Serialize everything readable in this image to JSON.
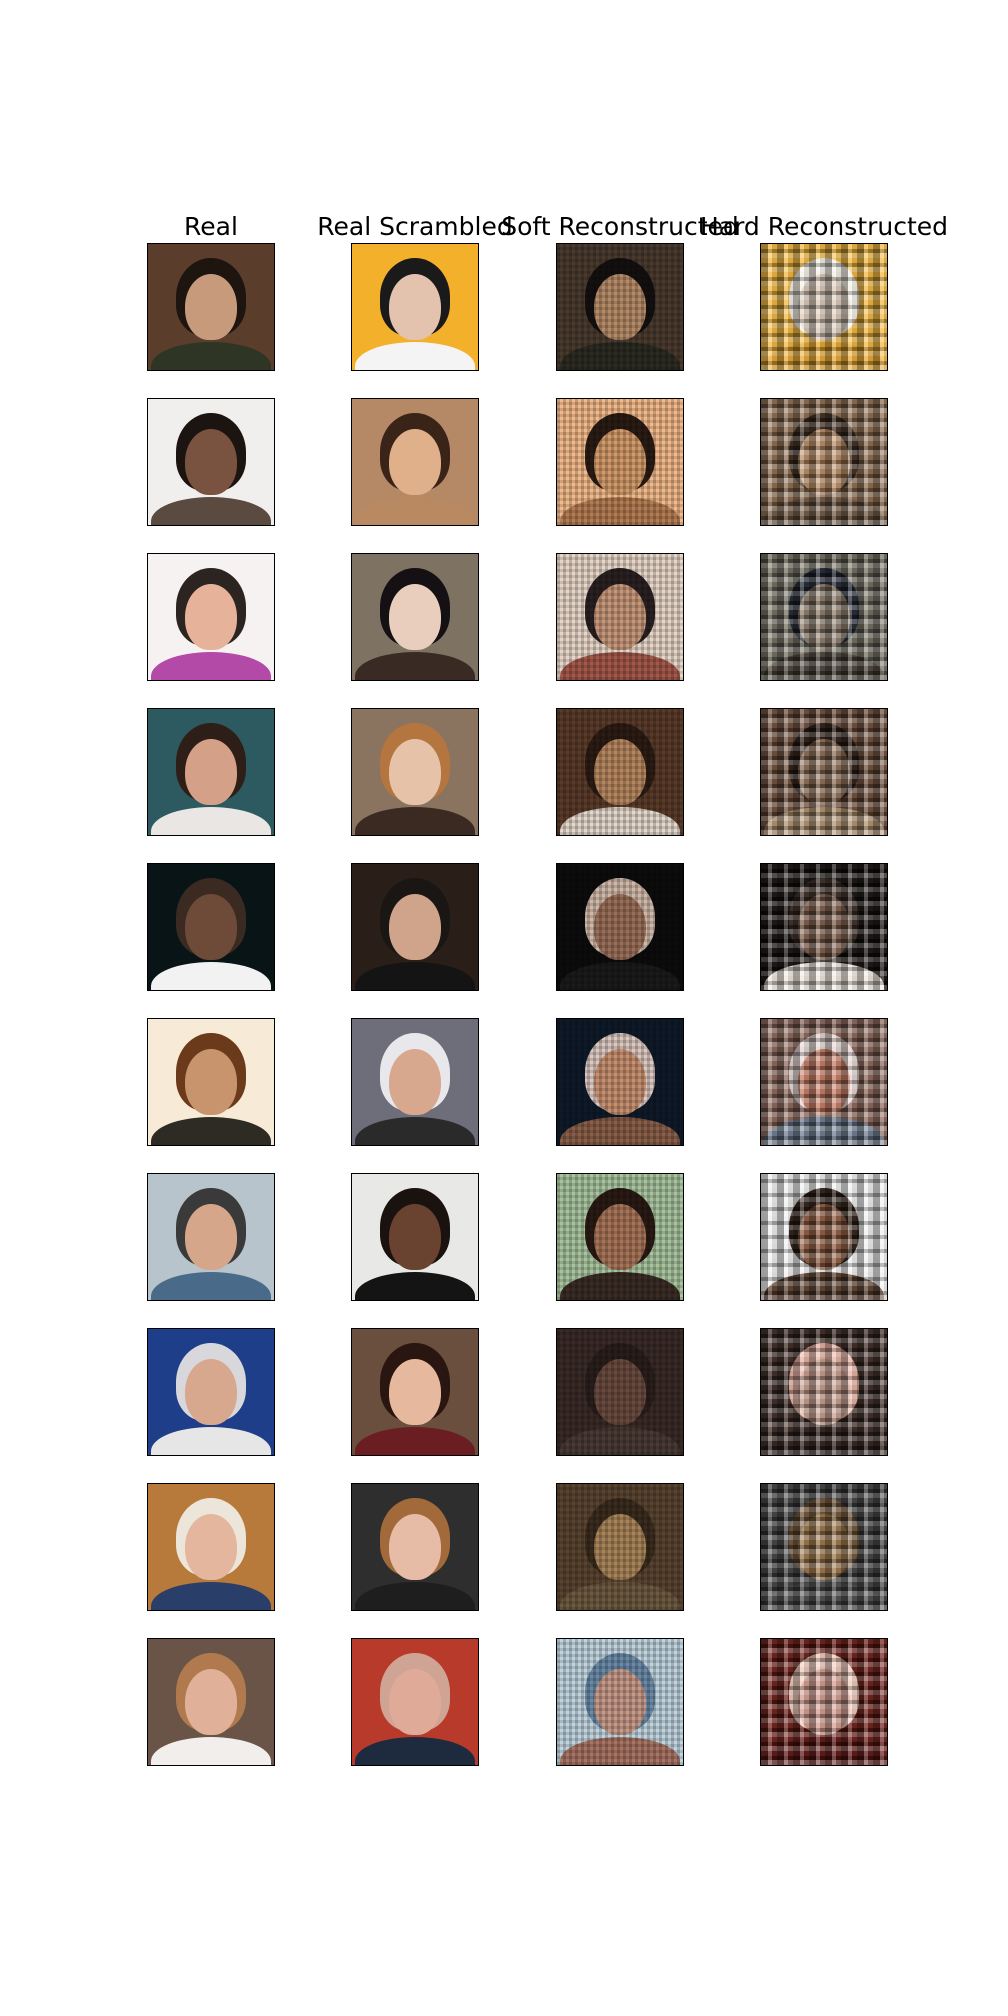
{
  "columns": [
    {
      "id": "real",
      "title": "Real"
    },
    {
      "id": "real-scrambled",
      "title": "Real Scrambled"
    },
    {
      "id": "soft-reconstructed",
      "title": "Soft Reconstructed"
    },
    {
      "id": "hard-reconstructed",
      "title": "Hard Reconstructed"
    }
  ],
  "rows": [
    [
      {
        "bg": "#5a3e2b",
        "skin": "#c89a7c",
        "hair": "#1e1410",
        "cloth": "#2f3524"
      },
      {
        "bg": "#f3b02a",
        "skin": "#e3c2ae",
        "hair": "#1a1a1a",
        "cloth": "#f4f4f4"
      },
      {
        "bg": "#4a3a2e",
        "skin": "#b58a66",
        "hair": "#141010",
        "cloth": "#2b2b22"
      },
      {
        "bg": "#f2b63a",
        "skin": "#d9c8b8",
        "hair": "#f4f0e6",
        "cloth": "#e8a72a"
      }
    ],
    [
      {
        "bg": "#f1efee",
        "skin": "#7a5340",
        "hair": "#1c1410",
        "cloth": "#5a4a40"
      },
      {
        "bg": "#b58866",
        "skin": "#e0b08a",
        "hair": "#3a2418",
        "cloth": "#b98a62"
      },
      {
        "bg": "#f2b98a",
        "skin": "#d39a6a",
        "hair": "#2a1c14",
        "cloth": "#b57c52"
      },
      {
        "bg": "#8a6a4c",
        "skin": "#b88a62",
        "hair": "#3c2a1e",
        "cloth": "#6e5640"
      }
    ],
    [
      {
        "bg": "#f6f2f2",
        "skin": "#e6b39a",
        "hair": "#2c2420",
        "cloth": "#b34aa8"
      },
      {
        "bg": "#7e7262",
        "skin": "#e9cdbd",
        "hair": "#141014",
        "cloth": "#3a2a24"
      },
      {
        "bg": "#e7d6c8",
        "skin": "#c7977a",
        "hair": "#2a2022",
        "cloth": "#a4584a"
      },
      {
        "bg": "#6e6a5c",
        "skin": "#8a7a68",
        "hair": "#1e2430",
        "cloth": "#4a4238"
      }
    ],
    [
      {
        "bg": "#2c5a60",
        "skin": "#d4a088",
        "hair": "#2e1e18",
        "cloth": "#eae6e4"
      },
      {
        "bg": "#8a7460",
        "skin": "#e6c2a8",
        "hair": "#b4763e",
        "cloth": "#3a2a22"
      },
      {
        "bg": "#5a3a28",
        "skin": "#b6865e",
        "hair": "#2c1c14",
        "cloth": "#e4d8cc"
      },
      {
        "bg": "#6c4a38",
        "skin": "#8a6a52",
        "hair": "#2a1a12",
        "cloth": "#b0906e"
      }
    ],
    [
      {
        "bg": "#081416",
        "skin": "#6e4a38",
        "hair": "#3a2a22",
        "cloth": "#f2f2f2"
      },
      {
        "bg": "#2a1e18",
        "skin": "#d0a48a",
        "hair": "#1a1614",
        "cloth": "#141414"
      },
      {
        "bg": "#0c0c0c",
        "skin": "#9a6e58",
        "hair": "#d0b8a8",
        "cloth": "#1a1a1a"
      },
      {
        "bg": "#120e0c",
        "skin": "#7a5a48",
        "hair": "#3a2a22",
        "cloth": "#f0e8e0"
      }
    ],
    [
      {
        "bg": "#f7ebd8",
        "skin": "#c8946e",
        "hair": "#6a3a1a",
        "cloth": "#2e2a24"
      },
      {
        "bg": "#6e6e7a",
        "skin": "#d8a88e",
        "hair": "#e8e8ec",
        "cloth": "#2a2a2a"
      },
      {
        "bg": "#0e1a2a",
        "skin": "#c89070",
        "hair": "#dcc8c0",
        "cloth": "#8a5e48"
      },
      {
        "bg": "#8a6458",
        "skin": "#c47860",
        "hair": "#e4d4d0",
        "cloth": "#6a7a8e"
      }
    ],
    [
      {
        "bg": "#b8c4cc",
        "skin": "#d6a68a",
        "hair": "#3a3a3a",
        "cloth": "#4a6a8a"
      },
      {
        "bg": "#e8e8e6",
        "skin": "#6a4230",
        "hair": "#1a120e",
        "cloth": "#141414"
      },
      {
        "bg": "#a8c49e",
        "skin": "#a87458",
        "hair": "#2a1a14",
        "cloth": "#3a2c24"
      },
      {
        "bg": "#eeeeee",
        "skin": "#8e5a3e",
        "hair": "#2c1c14",
        "cloth": "#5a3e2c"
      }
    ],
    [
      {
        "bg": "#1e3e8a",
        "skin": "#d8a88e",
        "hair": "#d8d8dc",
        "cloth": "#e6e6e6"
      },
      {
        "bg": "#6a4e3e",
        "skin": "#e6b89e",
        "hair": "#2a1610",
        "cloth": "#6a1e22"
      },
      {
        "bg": "#3a2a26",
        "skin": "#6a4a3e",
        "hair": "#2a1e1c",
        "cloth": "#4a3a34"
      },
      {
        "bg": "#3a2620",
        "skin": "#c49a8a",
        "hair": "#e8b0a0",
        "cloth": "#2e1e1a"
      }
    ],
    [
      {
        "bg": "#b87a3a",
        "skin": "#e4b69e",
        "hair": "#ece6da",
        "cloth": "#2a3e6a"
      },
      {
        "bg": "#2e2e2e",
        "skin": "#e6bca6",
        "hair": "#a26a3a",
        "cloth": "#1e1e1e"
      },
      {
        "bg": "#5a4430",
        "skin": "#a88458",
        "hair": "#3a2c1e",
        "cloth": "#6e5a40"
      },
      {
        "bg": "#3e3e3e",
        "skin": "#9a7446",
        "hair": "#6e5234",
        "cloth": "#4a4a4a"
      }
    ],
    [
      {
        "bg": "#6a5448",
        "skin": "#e0b098",
        "hair": "#b07a4e",
        "cloth": "#f2eeec"
      },
      {
        "bg": "#b83a2a",
        "skin": "#e0aa98",
        "hair": "#d0a494",
        "cloth": "#1e2a3e"
      },
      {
        "bg": "#c0d4e0",
        "skin": "#c89a8a",
        "hair": "#6a8aa8",
        "cloth": "#a87464"
      },
      {
        "bg": "#6a1a14",
        "skin": "#d49a8e",
        "hair": "#f0c8b8",
        "cloth": "#5a1210"
      }
    ]
  ]
}
